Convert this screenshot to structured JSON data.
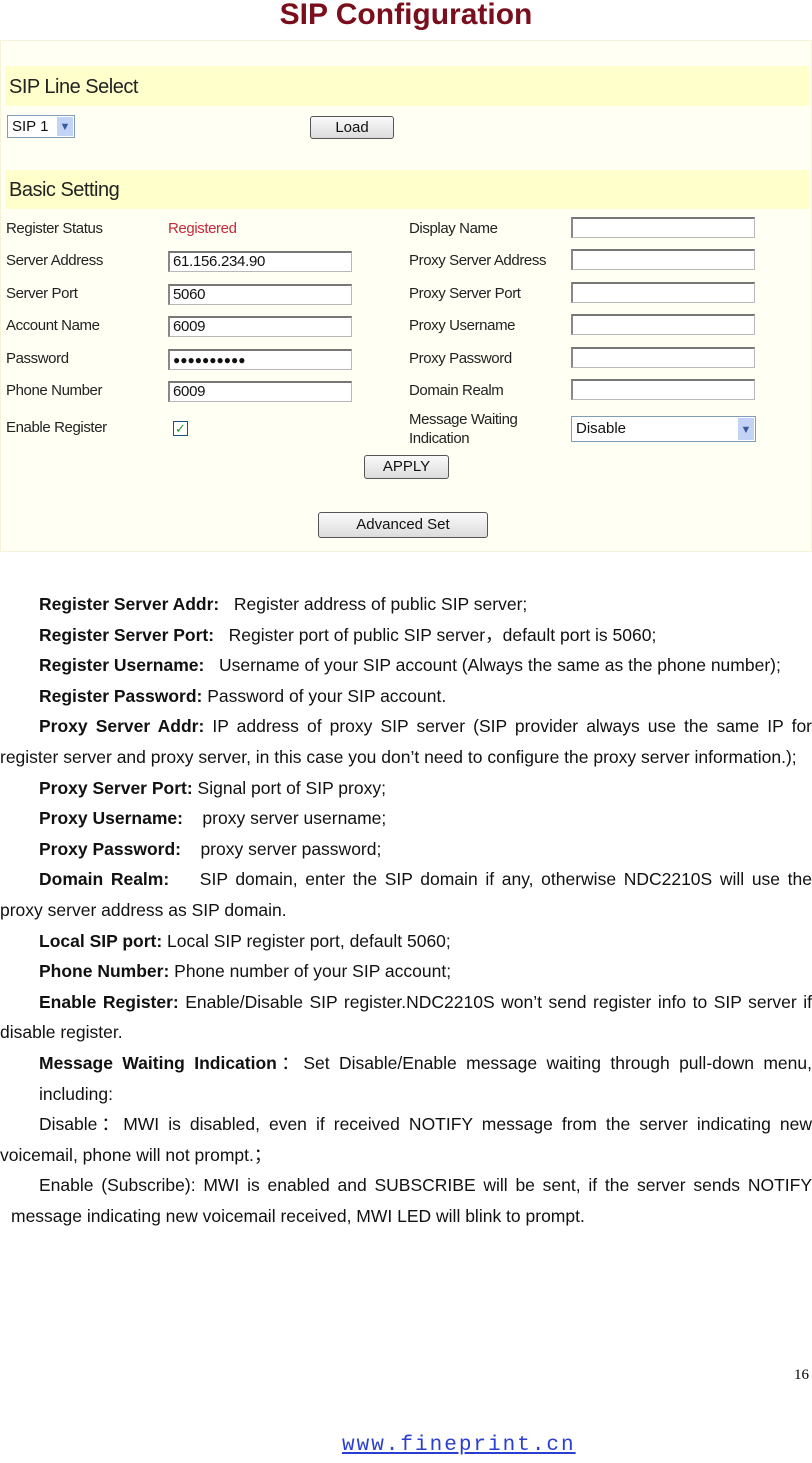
{
  "title": "SIP Configuration",
  "line_select": {
    "header": "SIP Line Select",
    "selected": "SIP 1",
    "load_label": "Load"
  },
  "basic": {
    "header": "Basic Setting",
    "left": [
      {
        "label": "Register Status",
        "value": "Registered"
      },
      {
        "label": "Server Address",
        "value": "61.156.234.90"
      },
      {
        "label": "Server Port",
        "value": "5060"
      },
      {
        "label": "Account Name",
        "value": "6009"
      },
      {
        "label": "Password",
        "value": "●●●●●●●●●●"
      },
      {
        "label": "Phone Number",
        "value": "6009"
      },
      {
        "label": "Enable Register",
        "checked": true
      }
    ],
    "right": [
      {
        "label": "Display Name",
        "value": ""
      },
      {
        "label": "Proxy Server Address",
        "value": ""
      },
      {
        "label": "Proxy Server Port",
        "value": ""
      },
      {
        "label": "Proxy Username",
        "value": ""
      },
      {
        "label": "Proxy Password",
        "value": ""
      },
      {
        "label": "Domain Realm",
        "value": ""
      },
      {
        "label": "Message Waiting Indication",
        "value": "Disable"
      }
    ],
    "apply_label": "APPLY",
    "advanced_label": "Advanced Set",
    "status_color": "#c8283c"
  },
  "desc": [
    {
      "term": "Register Server Addr:",
      "text": "   Register address of public SIP server;"
    },
    {
      "term": "Register Server Port:",
      "text": "   Register port of public SIP server，default port is 5060;"
    },
    {
      "term": "Register Username:",
      "text": "   Username of your SIP account (Always the same as the phone number);"
    },
    {
      "term": "Register Password:",
      "text": " Password of your SIP account."
    },
    {
      "term": "Proxy Server Addr:",
      "text": " IP address of proxy SIP server (SIP provider always use the same IP for register server and proxy server, in this case you don’t need to configure the proxy server information.);"
    },
    {
      "term": "Proxy Server Port:",
      "text": " Signal port of SIP proxy;"
    },
    {
      "term": "Proxy Username:",
      "text": "    proxy server username;"
    },
    {
      "term": "Proxy Password:",
      "text": "    proxy server password;"
    },
    {
      "term": "Domain Realm:",
      "text": "    SIP domain, enter the SIP domain if any, otherwise NDC2210S will use the proxy server address as SIP domain."
    },
    {
      "term": "Local SIP port:",
      "text": " Local SIP register port, default 5060;"
    },
    {
      "term": "Phone Number:",
      "text": " Phone number of your SIP account;"
    },
    {
      "term": "Enable Register:",
      "text": " Enable/Disable SIP register.NDC2210S won’t send register info to SIP server if disable register."
    },
    {
      "term": "Message Waiting Indication",
      "text": "：Set Disable/Enable message waiting through pull-down menu, including:"
    }
  ],
  "mwi_disable": "Disable：MWI is disabled, even if received NOTIFY message from the server indicating new voicemail, phone will not prompt.；",
  "mwi_enable": "Enable (Subscribe): MWI is enabled and SUBSCRIBE will be sent, if the server sends NOTIFY message indicating new voicemail received, MWI LED will blink to prompt.",
  "page_number": "16",
  "footer_link": "www.fineprint.cn"
}
